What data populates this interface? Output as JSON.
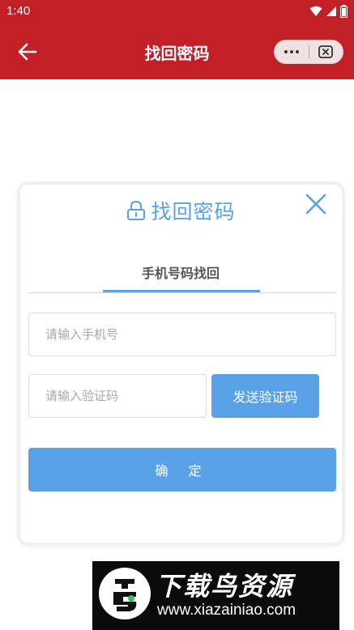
{
  "status_bar": {
    "time": "1:40"
  },
  "header": {
    "title": "找回密码"
  },
  "card": {
    "title": "找回密码",
    "tab_label": "手机号码找回",
    "phone_placeholder": "请输入手机号",
    "code_placeholder": "请输入验证码",
    "send_code_label": "发送验证码",
    "confirm_label": "确 定"
  },
  "watermark": {
    "title": "下载鸟资源",
    "url": "www.xiazainiao.com"
  },
  "colors": {
    "header_bg": "#c21f26",
    "accent": "#5aa2e8"
  },
  "icons": [
    "back-arrow-icon",
    "more-icon",
    "capsule-close-icon",
    "lock-icon",
    "close-icon",
    "wifi-icon",
    "signal-icon",
    "battery-icon"
  ]
}
